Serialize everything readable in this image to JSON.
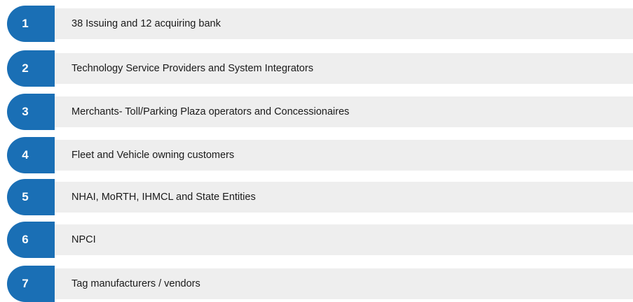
{
  "accent_color": "#1a6fb5",
  "bar_color": "#eeeeee",
  "items": [
    {
      "number": "1",
      "label": "38 Issuing and 12 acquiring bank"
    },
    {
      "number": "2",
      "label": "Technology Service Providers and System Integrators"
    },
    {
      "number": "3",
      "label": "Merchants- Toll/Parking Plaza operators and Concessionaires"
    },
    {
      "number": "4",
      "label": "Fleet and Vehicle owning customers"
    },
    {
      "number": "5",
      "label": "NHAI, MoRTH, IHMCL and State Entities"
    },
    {
      "number": "6",
      "label": "NPCI"
    },
    {
      "number": "7",
      "label": "Tag manufacturers / vendors"
    }
  ]
}
